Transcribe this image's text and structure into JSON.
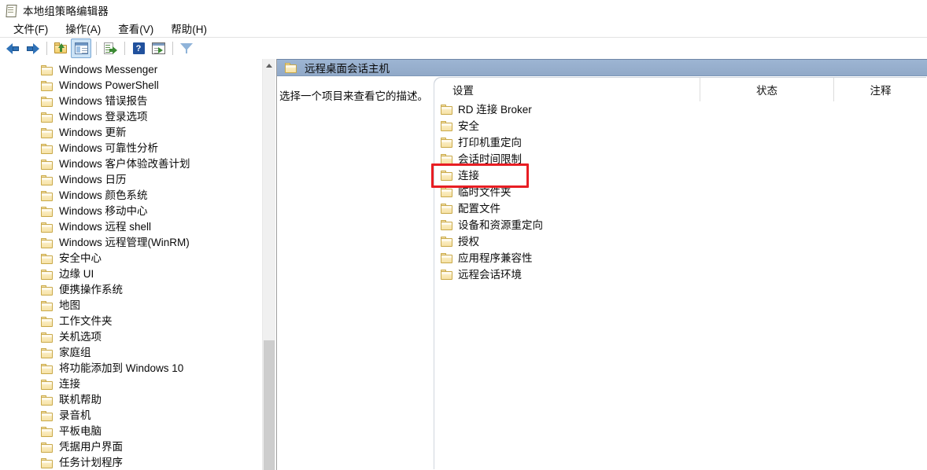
{
  "window": {
    "title": "本地组策略编辑器",
    "app_icon": "policy-editor-icon"
  },
  "menubar": {
    "items": [
      {
        "label": "文件(F)",
        "name": "menu-file"
      },
      {
        "label": "操作(A)",
        "name": "menu-action"
      },
      {
        "label": "查看(V)",
        "name": "menu-view"
      },
      {
        "label": "帮助(H)",
        "name": "menu-help"
      }
    ]
  },
  "toolbar": {
    "buttons": [
      {
        "name": "back-arrow-icon",
        "title": "后退"
      },
      {
        "name": "forward-arrow-icon",
        "title": "前进"
      },
      {
        "name": "up-one-level-icon",
        "title": "上移一级"
      },
      {
        "name": "show-hide-tree-icon",
        "title": "显示/隐藏控制台树"
      },
      {
        "name": "export-list-icon",
        "title": "导出列表"
      },
      {
        "name": "help-icon",
        "title": "帮助"
      },
      {
        "name": "show-window-icon",
        "title": "显示窗口"
      },
      {
        "name": "filter-icon",
        "title": "筛选器"
      }
    ],
    "help_glyph": "?"
  },
  "tree": {
    "items": [
      {
        "label": "Windows Messenger",
        "expandable": false
      },
      {
        "label": "Windows PowerShell",
        "expandable": false
      },
      {
        "label": "Windows 错误报告",
        "expandable": true
      },
      {
        "label": "Windows 登录选项",
        "expandable": false
      },
      {
        "label": "Windows 更新",
        "expandable": true
      },
      {
        "label": "Windows 可靠性分析",
        "expandable": false
      },
      {
        "label": "Windows 客户体验改善计划",
        "expandable": false
      },
      {
        "label": "Windows 日历",
        "expandable": false
      },
      {
        "label": "Windows 颜色系统",
        "expandable": false
      },
      {
        "label": "Windows 移动中心",
        "expandable": false
      },
      {
        "label": "Windows 远程 shell",
        "expandable": false
      },
      {
        "label": "Windows 远程管理(WinRM)",
        "expandable": true
      },
      {
        "label": "安全中心",
        "expandable": false
      },
      {
        "label": "边缘 UI",
        "expandable": false
      },
      {
        "label": "便携操作系统",
        "expandable": false
      },
      {
        "label": "地图",
        "expandable": false
      },
      {
        "label": "工作文件夹",
        "expandable": false
      },
      {
        "label": "关机选项",
        "expandable": false
      },
      {
        "label": "家庭组",
        "expandable": false
      },
      {
        "label": "将功能添加到 Windows 10",
        "expandable": false
      },
      {
        "label": "连接",
        "expandable": false
      },
      {
        "label": "联机帮助",
        "expandable": false
      },
      {
        "label": "录音机",
        "expandable": false
      },
      {
        "label": "平板电脑",
        "expandable": true
      },
      {
        "label": "凭据用户界面",
        "expandable": false
      },
      {
        "label": "任务计划程序",
        "expandable": false
      }
    ],
    "chevron_glyph": "›"
  },
  "right_pane": {
    "header_title": "远程桌面会话主机",
    "description": "选择一个项目来查看它的描述。",
    "columns": {
      "settings": "设置",
      "status": "状态",
      "comment": "注释"
    },
    "items": [
      {
        "label": "RD 连接 Broker",
        "highlighted": false
      },
      {
        "label": "安全",
        "highlighted": false
      },
      {
        "label": "打印机重定向",
        "highlighted": false
      },
      {
        "label": "会话时间限制",
        "highlighted": false
      },
      {
        "label": "连接",
        "highlighted": true
      },
      {
        "label": "临时文件夹",
        "highlighted": false
      },
      {
        "label": "配置文件",
        "highlighted": false
      },
      {
        "label": "设备和资源重定向",
        "highlighted": false
      },
      {
        "label": "授权",
        "highlighted": false
      },
      {
        "label": "应用程序兼容性",
        "highlighted": false
      },
      {
        "label": "远程会话环境",
        "highlighted": false
      }
    ]
  },
  "annotation": {
    "highlight_color": "#e81d23",
    "target_label": "连接"
  }
}
